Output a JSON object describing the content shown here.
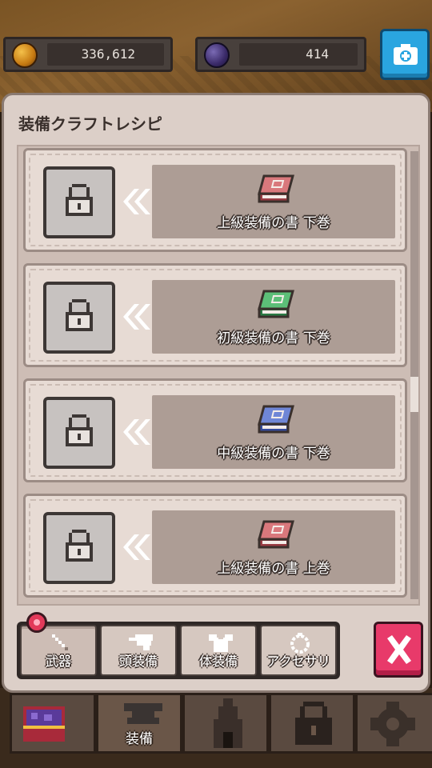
{
  "currencies": {
    "gold": {
      "icon": "gold-coin-icon",
      "value": "336,612"
    },
    "gem": {
      "icon": "dark-gem-icon",
      "value": "414"
    }
  },
  "panel": {
    "title": "装備クラフトレシピ"
  },
  "recipes": [
    {
      "name": "上級装備の書 下巻",
      "book_color": "#d9787c",
      "book_dark": "#9a3c44"
    },
    {
      "name": "初級装備の書 下巻",
      "book_color": "#5cbf78",
      "book_dark": "#2a7a44"
    },
    {
      "name": "中級装備の書 下巻",
      "book_color": "#6f86d6",
      "book_dark": "#344a9c"
    },
    {
      "name": "上級装備の書 上巻",
      "book_color": "#d9787c",
      "book_dark": "#9a3c44"
    }
  ],
  "tabs": [
    {
      "label": "武器",
      "icon": "sword-icon",
      "active": true,
      "badge": true
    },
    {
      "label": "頭装備",
      "icon": "helmet-icon",
      "active": false
    },
    {
      "label": "体装備",
      "icon": "armor-icon",
      "active": false
    },
    {
      "label": "アクセサリ",
      "icon": "ring-icon",
      "active": false
    }
  ],
  "bottom_nav": [
    {
      "label": "",
      "icon": "treasure-chest-icon"
    },
    {
      "label": "装備",
      "icon": "anvil-icon",
      "active": true
    },
    {
      "label": "",
      "icon": "tower-icon"
    },
    {
      "label": "",
      "icon": "locked-feature-icon"
    },
    {
      "label": "",
      "icon": "settings-gear-icon"
    }
  ],
  "colors": {
    "panel_bg": "#dccfc8",
    "close_button": "#e83a6a",
    "camera_button": "#2aa5e0"
  }
}
